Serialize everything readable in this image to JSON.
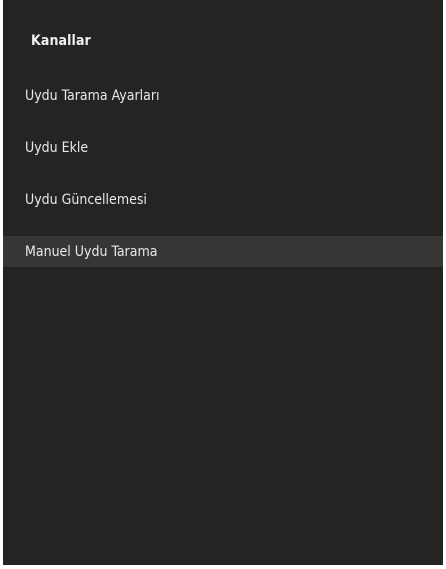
{
  "panel": {
    "title": "Kanallar"
  },
  "menu": {
    "items": [
      {
        "label": "Uydu Tarama Ayarları"
      },
      {
        "label": "Uydu Ekle"
      },
      {
        "label": "Uydu Güncellemesi"
      },
      {
        "label": "Manuel Uydu Tarama",
        "selected": true
      }
    ]
  },
  "colors": {
    "panel_background": "#262422",
    "selected_background": "#383634",
    "text": "#e8e8e8"
  }
}
